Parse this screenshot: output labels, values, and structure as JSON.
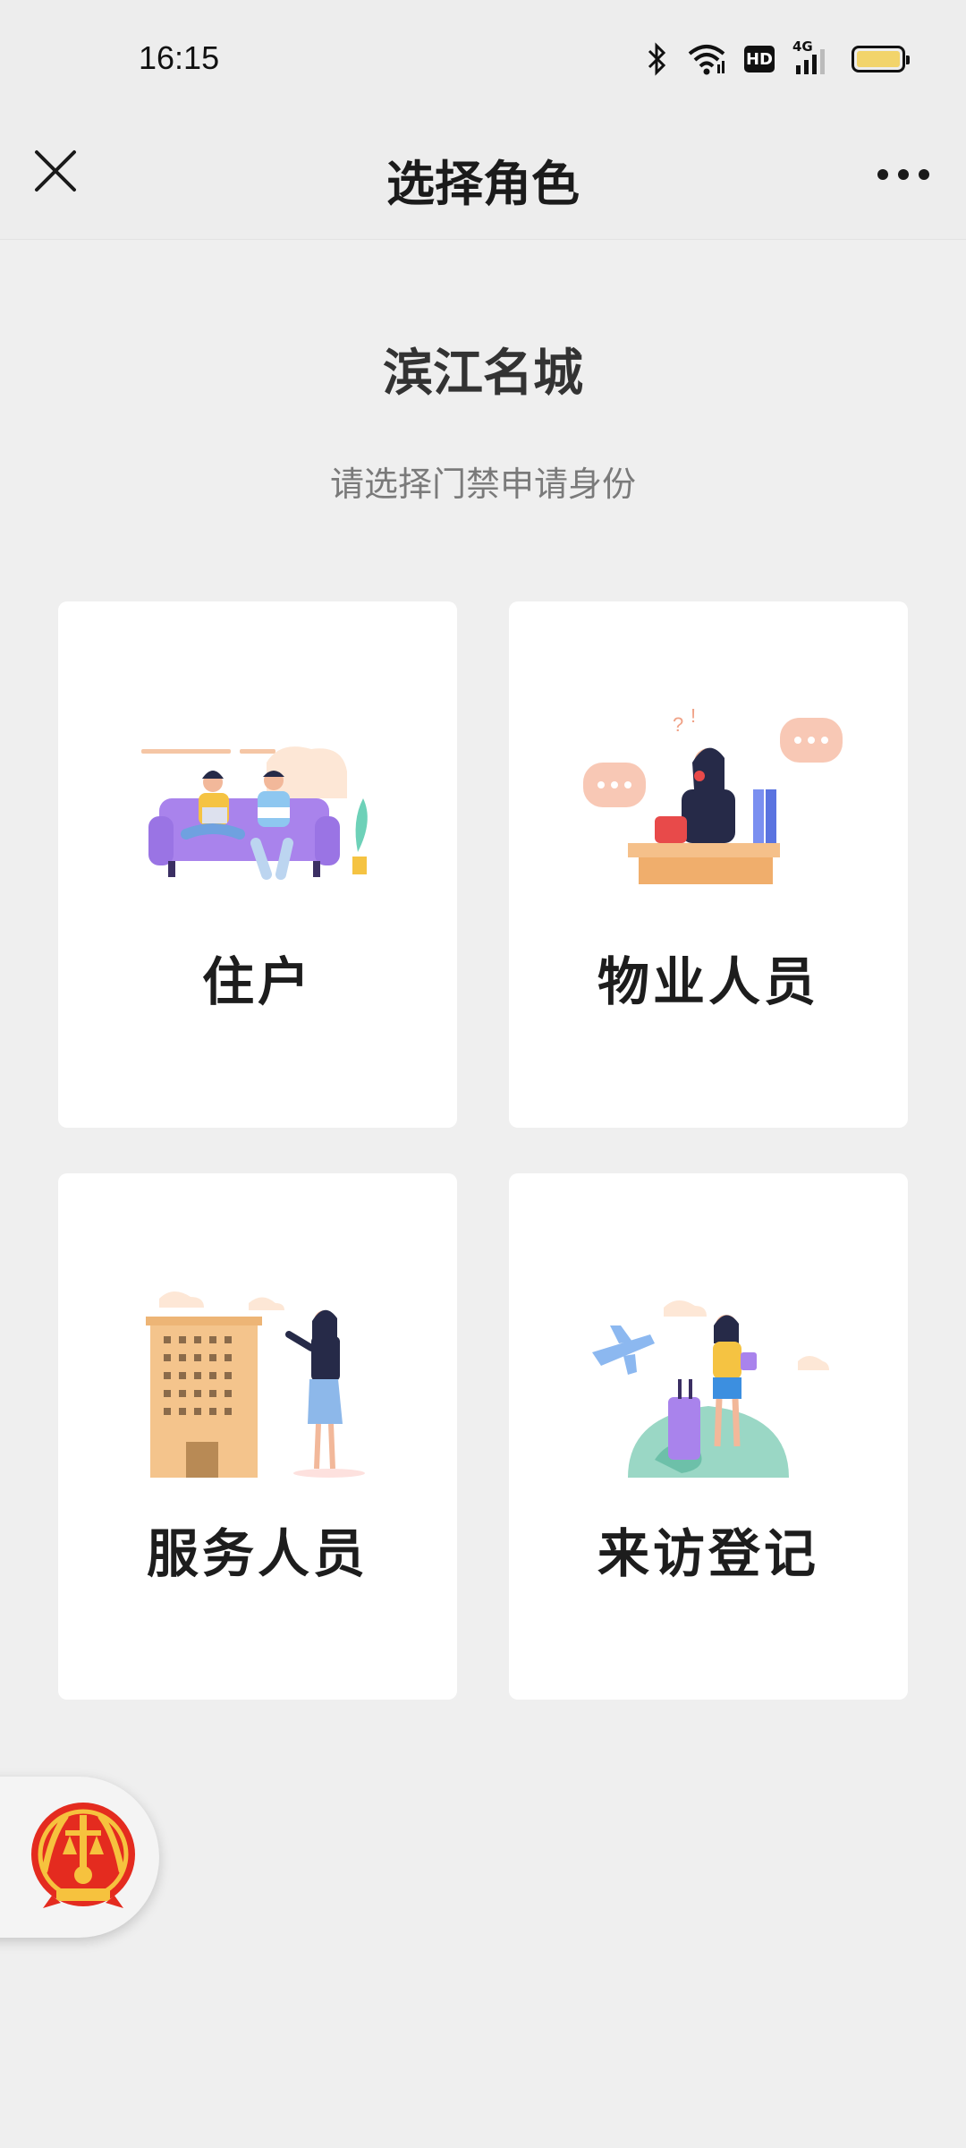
{
  "status_bar": {
    "time": "16:15",
    "icons": [
      "bluetooth-icon",
      "wifi-icon",
      "hd-icon",
      "4g-signal-icon",
      "battery-icon"
    ],
    "hd_label": "HD",
    "network_label": "4G"
  },
  "nav": {
    "title": "选择角色",
    "close_icon": "close-icon",
    "more_icon": "more-icon"
  },
  "header": {
    "community_name": "滨江名城",
    "subtitle": "请选择门禁申请身份"
  },
  "roles": [
    {
      "label": "住户",
      "illustration": "residents-on-sofa-illustration"
    },
    {
      "label": "物业人员",
      "illustration": "property-staff-at-desk-illustration"
    },
    {
      "label": "服务人员",
      "illustration": "service-staff-building-illustration"
    },
    {
      "label": "来访登记",
      "illustration": "visitor-with-luggage-illustration"
    }
  ],
  "floating_button": {
    "icon": "court-emblem-icon"
  },
  "colors": {
    "background": "#efefef",
    "nav_background": "#ededed",
    "card_background": "#ffffff",
    "subtitle_text": "#7a7a7a"
  }
}
